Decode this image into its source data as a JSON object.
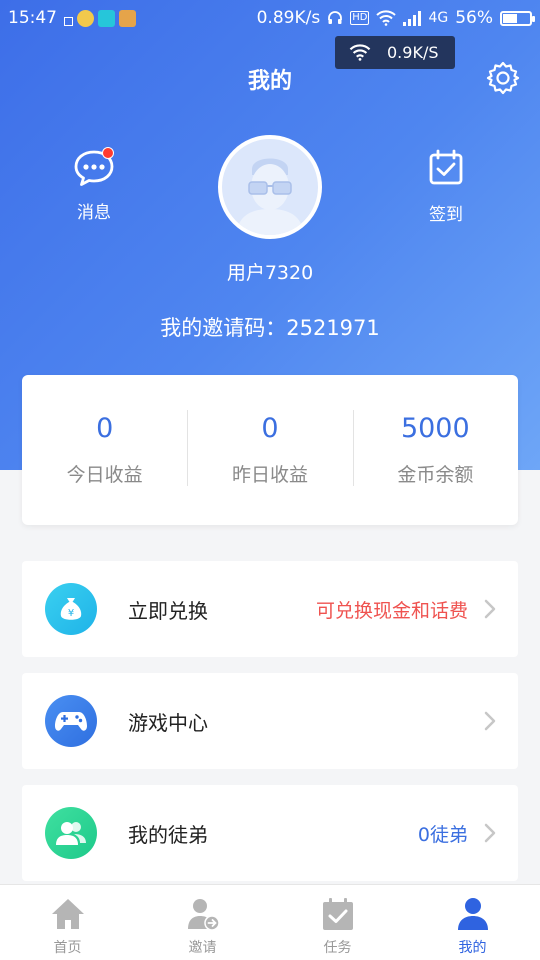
{
  "status_bar": {
    "time": "15:47",
    "net_speed": "0.89K/s",
    "hd": "HD",
    "network": "4G",
    "battery": "56%",
    "battery_level": 0.56
  },
  "speed_overlay": "0.9K/S",
  "header": {
    "title": "我的",
    "message_label": "消息",
    "signin_label": "签到"
  },
  "profile": {
    "username": "用户7320",
    "invite_code": "我的邀请码：2521971"
  },
  "stats": [
    {
      "value": "0",
      "label": "今日收益"
    },
    {
      "value": "0",
      "label": "昨日收益"
    },
    {
      "value": "5000",
      "label": "金币余额"
    }
  ],
  "menu": {
    "exchange": {
      "title": "立即兑换",
      "value": "可兑换现金和话费"
    },
    "games": {
      "title": "游戏中心",
      "value": ""
    },
    "apprentices": {
      "title": "我的徒弟",
      "value": "0徒弟"
    }
  },
  "tabs": [
    {
      "label": "首页"
    },
    {
      "label": "邀请"
    },
    {
      "label": "任务"
    },
    {
      "label": "我的"
    }
  ],
  "colors": {
    "primary": "#3b6fe0",
    "accent_red": "#ef5350",
    "active_tab": "#2f63e0"
  }
}
